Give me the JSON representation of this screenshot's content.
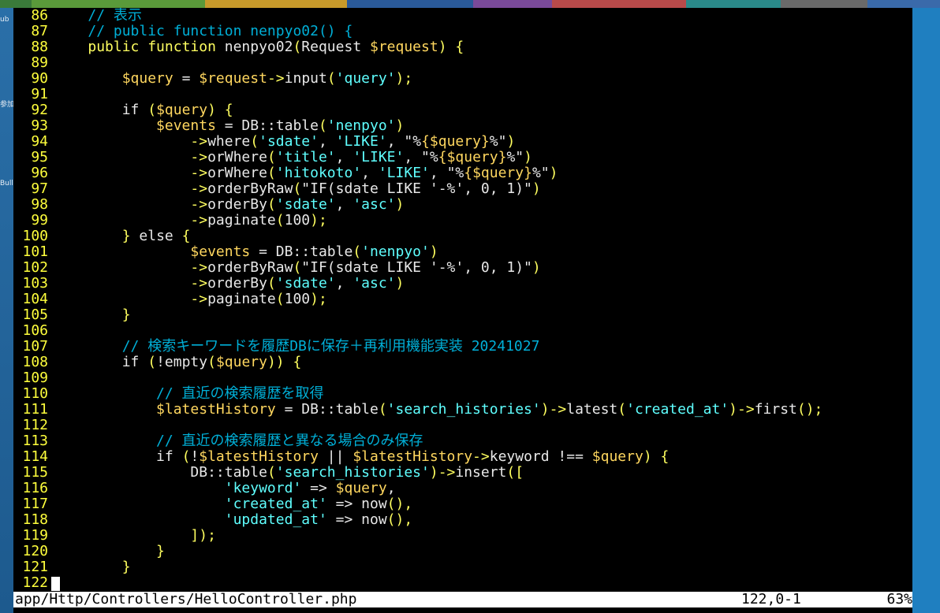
{
  "desktop": {
    "strip_colors": [
      "#3a7a3a",
      "#5a9a3a",
      "#c89a2a",
      "#2a5a9a",
      "#7a4a9a",
      "#b84a4a",
      "#2a8a8a",
      "#6a6a6a",
      "#3a6aaa"
    ],
    "side_labels": [
      "ub",
      "参加",
      "Bull"
    ]
  },
  "editor": {
    "file_path": "app/Http/Controllers/HelloController.php",
    "cursor_position": "122,0-1",
    "scroll_percent": "63%",
    "lines": [
      {
        "num": "86",
        "indent": "    ",
        "tokens": [
          {
            "t": "// 表示",
            "c": "c"
          }
        ]
      },
      {
        "num": "87",
        "indent": "    ",
        "tokens": [
          {
            "t": "// public function nenpyo02() {",
            "c": "c"
          }
        ]
      },
      {
        "num": "88",
        "indent": "    ",
        "tokens": [
          {
            "t": "public function ",
            "c": "k"
          },
          {
            "t": "nenpyo02",
            "c": "w"
          },
          {
            "t": "(",
            "c": "p"
          },
          {
            "t": "Request ",
            "c": "w"
          },
          {
            "t": "$request",
            "c": "v"
          },
          {
            "t": ") {",
            "c": "p"
          }
        ]
      },
      {
        "num": "89",
        "indent": "",
        "tokens": []
      },
      {
        "num": "90",
        "indent": "        ",
        "tokens": [
          {
            "t": "$query",
            "c": "v"
          },
          {
            "t": " = ",
            "c": "w"
          },
          {
            "t": "$request",
            "c": "v"
          },
          {
            "t": "->",
            "c": "p"
          },
          {
            "t": "input",
            "c": "w"
          },
          {
            "t": "(",
            "c": "p"
          },
          {
            "t": "'query'",
            "c": "s"
          },
          {
            "t": ");",
            "c": "p"
          }
        ]
      },
      {
        "num": "91",
        "indent": "",
        "tokens": []
      },
      {
        "num": "92",
        "indent": "        ",
        "tokens": [
          {
            "t": "if ",
            "c": "w"
          },
          {
            "t": "(",
            "c": "p"
          },
          {
            "t": "$query",
            "c": "v"
          },
          {
            "t": ") {",
            "c": "p"
          }
        ]
      },
      {
        "num": "93",
        "indent": "            ",
        "tokens": [
          {
            "t": "$events",
            "c": "v"
          },
          {
            "t": " = DB::table",
            "c": "w"
          },
          {
            "t": "(",
            "c": "p"
          },
          {
            "t": "'nenpyo'",
            "c": "s"
          },
          {
            "t": ")",
            "c": "p"
          }
        ]
      },
      {
        "num": "94",
        "indent": "                ",
        "tokens": [
          {
            "t": "->",
            "c": "p"
          },
          {
            "t": "where",
            "c": "w"
          },
          {
            "t": "(",
            "c": "p"
          },
          {
            "t": "'sdate'",
            "c": "s"
          },
          {
            "t": ", ",
            "c": "w"
          },
          {
            "t": "'LIKE'",
            "c": "s"
          },
          {
            "t": ", ",
            "c": "w"
          },
          {
            "t": "\"%",
            "c": "w"
          },
          {
            "t": "{$query}",
            "c": "v"
          },
          {
            "t": "%\"",
            "c": "w"
          },
          {
            "t": ")",
            "c": "p"
          }
        ]
      },
      {
        "num": "95",
        "indent": "                ",
        "tokens": [
          {
            "t": "->",
            "c": "p"
          },
          {
            "t": "orWhere",
            "c": "w"
          },
          {
            "t": "(",
            "c": "p"
          },
          {
            "t": "'title'",
            "c": "s"
          },
          {
            "t": ", ",
            "c": "w"
          },
          {
            "t": "'LIKE'",
            "c": "s"
          },
          {
            "t": ", ",
            "c": "w"
          },
          {
            "t": "\"%",
            "c": "w"
          },
          {
            "t": "{$query}",
            "c": "v"
          },
          {
            "t": "%\"",
            "c": "w"
          },
          {
            "t": ")",
            "c": "p"
          }
        ]
      },
      {
        "num": "96",
        "indent": "                ",
        "tokens": [
          {
            "t": "->",
            "c": "p"
          },
          {
            "t": "orWhere",
            "c": "w"
          },
          {
            "t": "(",
            "c": "p"
          },
          {
            "t": "'hitokoto'",
            "c": "s"
          },
          {
            "t": ", ",
            "c": "w"
          },
          {
            "t": "'LIKE'",
            "c": "s"
          },
          {
            "t": ", ",
            "c": "w"
          },
          {
            "t": "\"%",
            "c": "w"
          },
          {
            "t": "{$query}",
            "c": "v"
          },
          {
            "t": "%\"",
            "c": "w"
          },
          {
            "t": ")",
            "c": "p"
          }
        ]
      },
      {
        "num": "97",
        "indent": "                ",
        "tokens": [
          {
            "t": "->",
            "c": "p"
          },
          {
            "t": "orderByRaw",
            "c": "w"
          },
          {
            "t": "(",
            "c": "p"
          },
          {
            "t": "\"IF(sdate LIKE '-%', 0, 1)\"",
            "c": "w"
          },
          {
            "t": ")",
            "c": "p"
          }
        ]
      },
      {
        "num": "98",
        "indent": "                ",
        "tokens": [
          {
            "t": "->",
            "c": "p"
          },
          {
            "t": "orderBy",
            "c": "w"
          },
          {
            "t": "(",
            "c": "p"
          },
          {
            "t": "'sdate'",
            "c": "s"
          },
          {
            "t": ", ",
            "c": "w"
          },
          {
            "t": "'asc'",
            "c": "s"
          },
          {
            "t": ")",
            "c": "p"
          }
        ]
      },
      {
        "num": "99",
        "indent": "                ",
        "tokens": [
          {
            "t": "->",
            "c": "p"
          },
          {
            "t": "paginate",
            "c": "w"
          },
          {
            "t": "(",
            "c": "p"
          },
          {
            "t": "100",
            "c": "w"
          },
          {
            "t": ");",
            "c": "p"
          }
        ]
      },
      {
        "num": "100",
        "indent": "        ",
        "tokens": [
          {
            "t": "} ",
            "c": "p"
          },
          {
            "t": "else ",
            "c": "w"
          },
          {
            "t": "{",
            "c": "p"
          }
        ]
      },
      {
        "num": "101",
        "indent": "                ",
        "tokens": [
          {
            "t": "$events",
            "c": "v"
          },
          {
            "t": " = DB::table",
            "c": "w"
          },
          {
            "t": "(",
            "c": "p"
          },
          {
            "t": "'nenpyo'",
            "c": "s"
          },
          {
            "t": ")",
            "c": "p"
          }
        ]
      },
      {
        "num": "102",
        "indent": "                ",
        "tokens": [
          {
            "t": "->",
            "c": "p"
          },
          {
            "t": "orderByRaw",
            "c": "w"
          },
          {
            "t": "(",
            "c": "p"
          },
          {
            "t": "\"IF(sdate LIKE '-%', 0, 1)\"",
            "c": "w"
          },
          {
            "t": ")",
            "c": "p"
          }
        ]
      },
      {
        "num": "103",
        "indent": "                ",
        "tokens": [
          {
            "t": "->",
            "c": "p"
          },
          {
            "t": "orderBy",
            "c": "w"
          },
          {
            "t": "(",
            "c": "p"
          },
          {
            "t": "'sdate'",
            "c": "s"
          },
          {
            "t": ", ",
            "c": "w"
          },
          {
            "t": "'asc'",
            "c": "s"
          },
          {
            "t": ")",
            "c": "p"
          }
        ]
      },
      {
        "num": "104",
        "indent": "                ",
        "tokens": [
          {
            "t": "->",
            "c": "p"
          },
          {
            "t": "paginate",
            "c": "w"
          },
          {
            "t": "(",
            "c": "p"
          },
          {
            "t": "100",
            "c": "w"
          },
          {
            "t": ");",
            "c": "p"
          }
        ]
      },
      {
        "num": "105",
        "indent": "        ",
        "tokens": [
          {
            "t": "}",
            "c": "p"
          }
        ]
      },
      {
        "num": "106",
        "indent": "",
        "tokens": []
      },
      {
        "num": "107",
        "indent": "        ",
        "tokens": [
          {
            "t": "// 検索キーワードを履歴DBに保存＋再利用機能実装 20241027",
            "c": "c"
          }
        ]
      },
      {
        "num": "108",
        "indent": "        ",
        "tokens": [
          {
            "t": "if ",
            "c": "w"
          },
          {
            "t": "(",
            "c": "p"
          },
          {
            "t": "!empty",
            "c": "w"
          },
          {
            "t": "(",
            "c": "p"
          },
          {
            "t": "$query",
            "c": "v"
          },
          {
            "t": ")) {",
            "c": "p"
          }
        ]
      },
      {
        "num": "109",
        "indent": "",
        "tokens": []
      },
      {
        "num": "110",
        "indent": "            ",
        "tokens": [
          {
            "t": "// 直近の検索履歴を取得",
            "c": "c"
          }
        ]
      },
      {
        "num": "111",
        "indent": "            ",
        "tokens": [
          {
            "t": "$latestHistory",
            "c": "v"
          },
          {
            "t": " = DB::table",
            "c": "w"
          },
          {
            "t": "(",
            "c": "p"
          },
          {
            "t": "'search_histories'",
            "c": "s"
          },
          {
            "t": ")->",
            "c": "p"
          },
          {
            "t": "latest",
            "c": "w"
          },
          {
            "t": "(",
            "c": "p"
          },
          {
            "t": "'created_at'",
            "c": "s"
          },
          {
            "t": ")->",
            "c": "p"
          },
          {
            "t": "first",
            "c": "w"
          },
          {
            "t": "();",
            "c": "p"
          }
        ]
      },
      {
        "num": "112",
        "indent": "",
        "tokens": []
      },
      {
        "num": "113",
        "indent": "            ",
        "tokens": [
          {
            "t": "// 直近の検索履歴と異なる場合のみ保存",
            "c": "c"
          }
        ]
      },
      {
        "num": "114",
        "indent": "            ",
        "tokens": [
          {
            "t": "if ",
            "c": "w"
          },
          {
            "t": "(",
            "c": "p"
          },
          {
            "t": "!",
            "c": "w"
          },
          {
            "t": "$latestHistory",
            "c": "v"
          },
          {
            "t": " || ",
            "c": "w"
          },
          {
            "t": "$latestHistory",
            "c": "v"
          },
          {
            "t": "->",
            "c": "p"
          },
          {
            "t": "keyword !== ",
            "c": "w"
          },
          {
            "t": "$query",
            "c": "v"
          },
          {
            "t": ") {",
            "c": "p"
          }
        ]
      },
      {
        "num": "115",
        "indent": "                ",
        "tokens": [
          {
            "t": "DB::table",
            "c": "w"
          },
          {
            "t": "(",
            "c": "p"
          },
          {
            "t": "'search_histories'",
            "c": "s"
          },
          {
            "t": ")->",
            "c": "p"
          },
          {
            "t": "insert",
            "c": "w"
          },
          {
            "t": "([",
            "c": "p"
          }
        ]
      },
      {
        "num": "116",
        "indent": "                    ",
        "tokens": [
          {
            "t": "'keyword'",
            "c": "s"
          },
          {
            "t": " => ",
            "c": "w"
          },
          {
            "t": "$query",
            "c": "v"
          },
          {
            "t": ",",
            "c": "w"
          }
        ]
      },
      {
        "num": "117",
        "indent": "                    ",
        "tokens": [
          {
            "t": "'created_at'",
            "c": "s"
          },
          {
            "t": " => ",
            "c": "w"
          },
          {
            "t": "now",
            "c": "w"
          },
          {
            "t": "(),",
            "c": "p"
          }
        ]
      },
      {
        "num": "118",
        "indent": "                    ",
        "tokens": [
          {
            "t": "'updated_at'",
            "c": "s"
          },
          {
            "t": " => ",
            "c": "w"
          },
          {
            "t": "now",
            "c": "w"
          },
          {
            "t": "(),",
            "c": "p"
          }
        ]
      },
      {
        "num": "119",
        "indent": "                ",
        "tokens": [
          {
            "t": "]);",
            "c": "p"
          }
        ]
      },
      {
        "num": "120",
        "indent": "            ",
        "tokens": [
          {
            "t": "}",
            "c": "p"
          }
        ]
      },
      {
        "num": "121",
        "indent": "        ",
        "tokens": [
          {
            "t": "}",
            "c": "p"
          }
        ]
      },
      {
        "num": "122",
        "indent": "",
        "tokens": []
      }
    ]
  }
}
